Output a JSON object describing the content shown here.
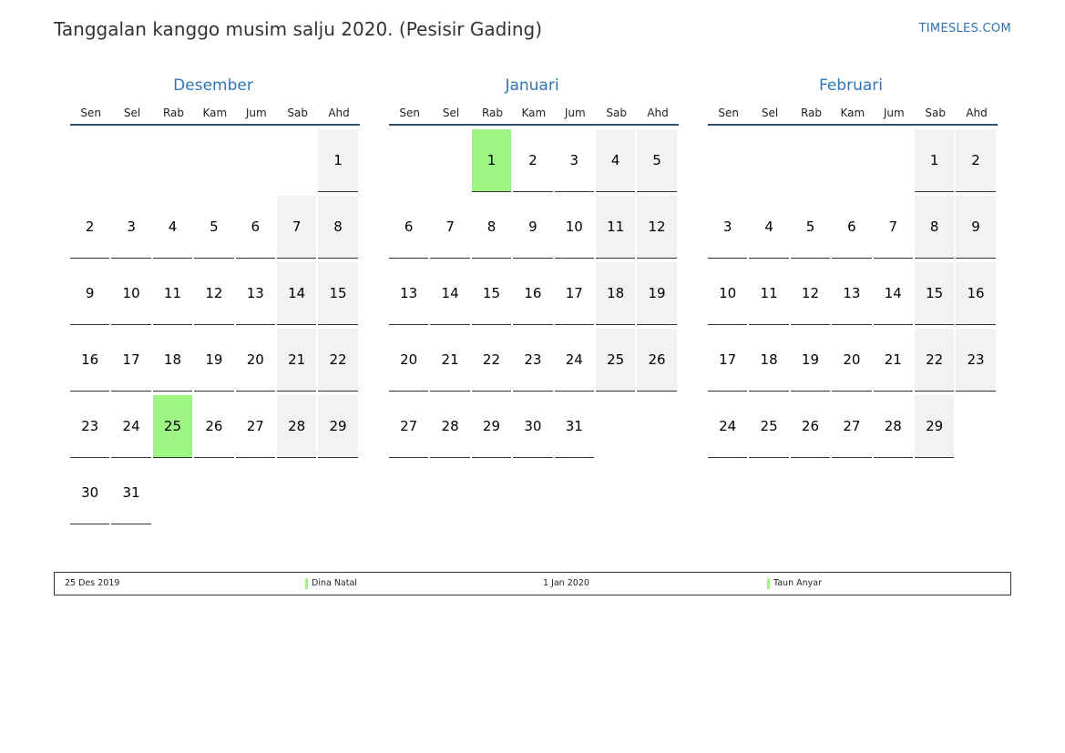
{
  "page": {
    "title": "Tanggalan kanggo musim salju 2020. (Pesisir Gading)",
    "site": "TIMESLES.COM"
  },
  "colors": {
    "accent": "#2f75b5",
    "holiday": "#9cf584",
    "weekend": "#f2f2f2"
  },
  "weekdays": [
    "Sen",
    "Sel",
    "Rab",
    "Kam",
    "Jum",
    "Sab",
    "Ahd"
  ],
  "months": [
    {
      "name": "Desember",
      "weeks": [
        [
          "",
          "",
          "",
          "",
          "",
          "",
          "1"
        ],
        [
          "2",
          "3",
          "4",
          "5",
          "6",
          "7",
          "8"
        ],
        [
          "9",
          "10",
          "11",
          "12",
          "13",
          "14",
          "15"
        ],
        [
          "16",
          "17",
          "18",
          "19",
          "20",
          "21",
          "22"
        ],
        [
          "23",
          "24",
          "25",
          "26",
          "27",
          "28",
          "29"
        ],
        [
          "30",
          "31",
          "",
          "",
          "",
          "",
          ""
        ]
      ],
      "holidays": [
        "25"
      ]
    },
    {
      "name": "Januari",
      "weeks": [
        [
          "",
          "",
          "1",
          "2",
          "3",
          "4",
          "5"
        ],
        [
          "6",
          "7",
          "8",
          "9",
          "10",
          "11",
          "12"
        ],
        [
          "13",
          "14",
          "15",
          "16",
          "17",
          "18",
          "19"
        ],
        [
          "20",
          "21",
          "22",
          "23",
          "24",
          "25",
          "26"
        ],
        [
          "27",
          "28",
          "29",
          "30",
          "31",
          "",
          ""
        ]
      ],
      "holidays": [
        "1"
      ]
    },
    {
      "name": "Februari",
      "weeks": [
        [
          "",
          "",
          "",
          "",
          "",
          "1",
          "2"
        ],
        [
          "3",
          "4",
          "5",
          "6",
          "7",
          "8",
          "9"
        ],
        [
          "10",
          "11",
          "12",
          "13",
          "14",
          "15",
          "16"
        ],
        [
          "17",
          "18",
          "19",
          "20",
          "21",
          "22",
          "23"
        ],
        [
          "24",
          "25",
          "26",
          "27",
          "28",
          "29",
          ""
        ]
      ],
      "holidays": []
    }
  ],
  "legend": [
    {
      "date": "25 Des 2019",
      "name": "Dina Natal"
    },
    {
      "date": "1 Jan 2020",
      "name": "Taun Anyar"
    }
  ]
}
